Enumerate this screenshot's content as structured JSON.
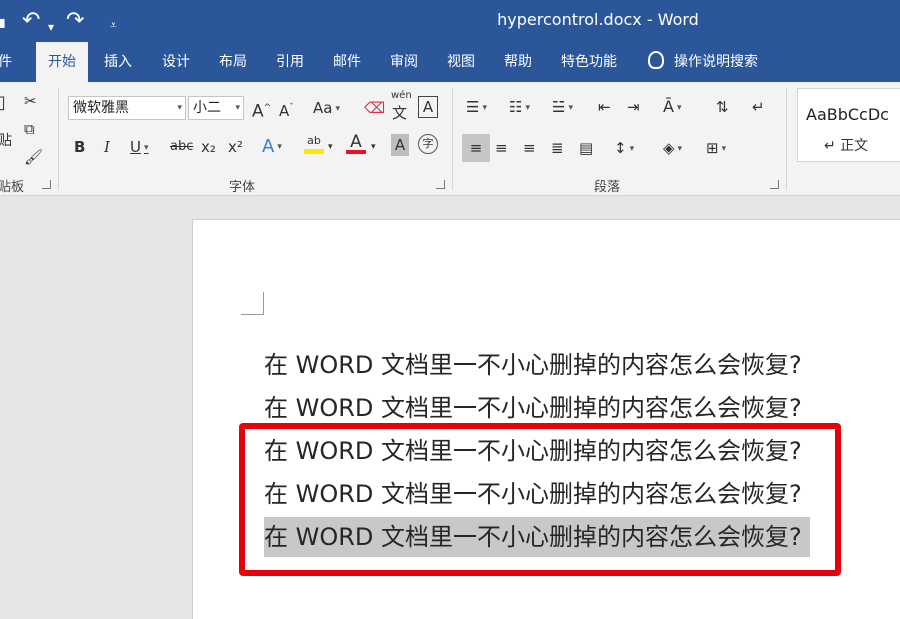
{
  "window": {
    "title": "hypercontrol.docx  -  Word"
  },
  "tabs": [
    {
      "label": "件"
    },
    {
      "label": "开始"
    },
    {
      "label": "插入"
    },
    {
      "label": "设计"
    },
    {
      "label": "布局"
    },
    {
      "label": "引用"
    },
    {
      "label": "邮件"
    },
    {
      "label": "审阅"
    },
    {
      "label": "视图"
    },
    {
      "label": "帮助"
    },
    {
      "label": "特色功能"
    }
  ],
  "tell_me": {
    "label": "操作说明搜索"
  },
  "ribbon": {
    "clipboard": {
      "paste_label": "贴",
      "group_label": "贴板"
    },
    "font": {
      "font_name": "微软雅黑",
      "font_size": "小二",
      "grow": "A",
      "shrink": "A",
      "change_case": "Aa",
      "phonetic_top": "wén",
      "phonetic_bottom": "文",
      "char_border": "A",
      "bold": "B",
      "italic": "I",
      "underline": "U",
      "strike": "abc",
      "sub": "x₂",
      "sup": "x²",
      "text_effect": "A",
      "highlight": "ab",
      "font_color": "A",
      "char_shading": "A",
      "enclose": "字",
      "group_label": "字体"
    },
    "paragraph": {
      "group_label": "段落"
    },
    "styles": {
      "sample": "AaBbCcDc",
      "name": "↵ 正文"
    }
  },
  "document": {
    "lines": [
      "在 WORD 文档里一不小心删掉的内容怎么会恢复?",
      "在 WORD 文档里一不小心删掉的内容怎么会恢复?",
      "在 WORD 文档里一不小心删掉的内容怎么会恢复?",
      "在 WORD 文档里一不小心删掉的内容怎么会恢复?",
      "在 WORD 文档里一不小心删掉的内容怎么会恢复?"
    ]
  },
  "colors": {
    "title_bar": "#2b579a",
    "ribbon": "#f3f3f3",
    "highlight_box": "#e8000b",
    "selection": "#c8c8c8",
    "highlight_yellow": "#ffe800",
    "font_color_red": "#e81123"
  }
}
